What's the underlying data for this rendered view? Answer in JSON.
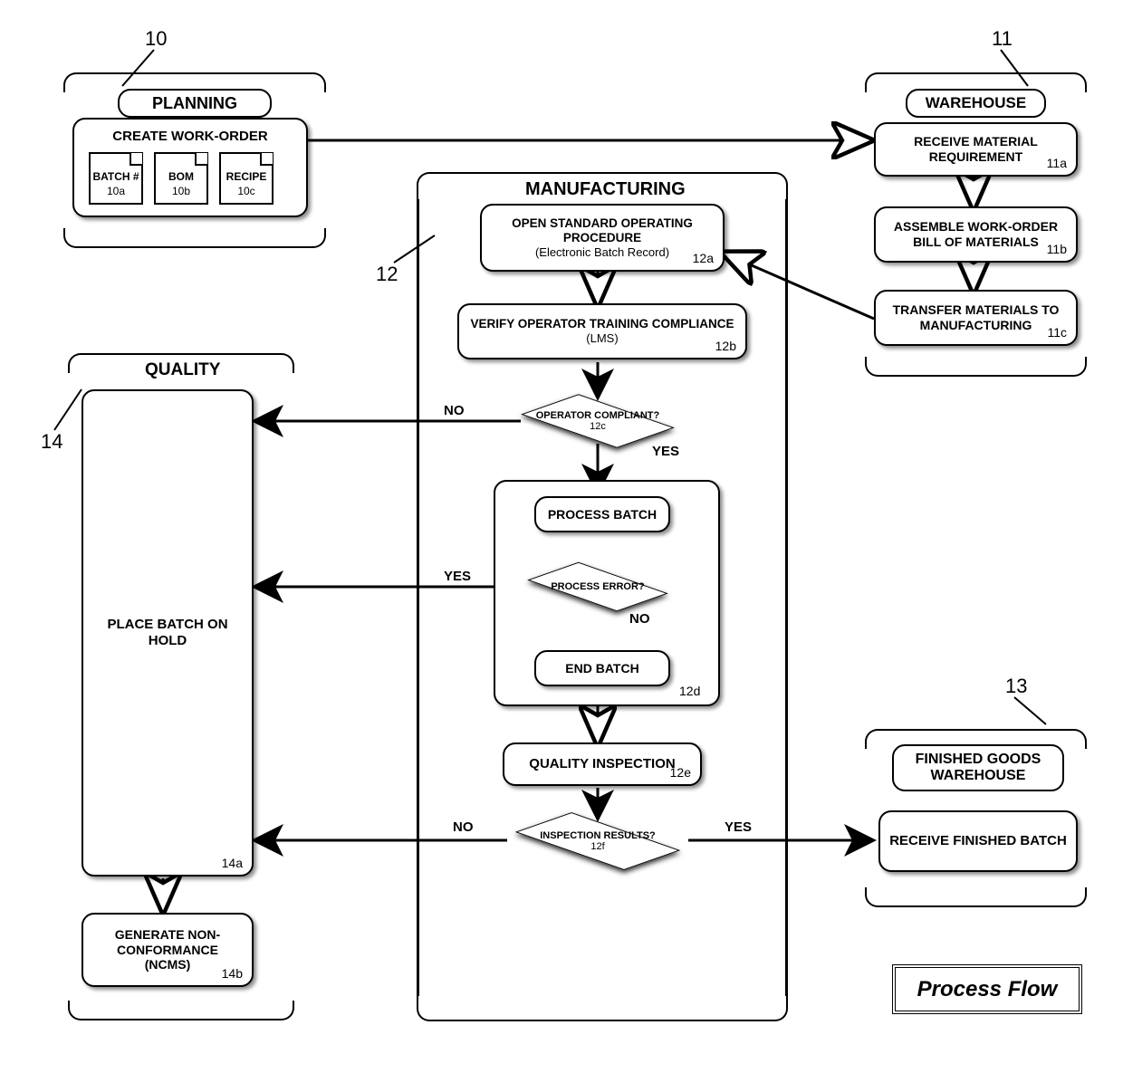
{
  "refs": {
    "planning": "10",
    "warehouse": "11",
    "manufacturing": "12",
    "finished": "13",
    "quality": "14"
  },
  "planning": {
    "title": "PLANNING",
    "create_wo": "CREATE WORK-ORDER",
    "docs": {
      "batch": {
        "label": "BATCH #",
        "tag": "10a"
      },
      "bom": {
        "label": "BOM",
        "tag": "10b"
      },
      "recipe": {
        "label": "RECIPE",
        "tag": "10c"
      }
    }
  },
  "warehouse": {
    "title": "WAREHOUSE",
    "recv": {
      "label": "RECEIVE MATERIAL REQUIREMENT",
      "tag": "11a"
    },
    "assemble": {
      "label": "ASSEMBLE WORK-ORDER BILL OF MATERIALS",
      "tag": "11b"
    },
    "transfer": {
      "label": "TRANSFER MATERIALS TO MANUFACTURING",
      "tag": "11c"
    }
  },
  "manufacturing": {
    "title": "MANUFACTURING",
    "open_sop": {
      "line1": "OPEN STANDARD OPERATING PROCEDURE",
      "line2": "(Electronic Batch Record)",
      "tag": "12a"
    },
    "verify": {
      "line1": "VERIFY OPERATOR TRAINING COMPLIANCE",
      "line2": "(LMS)",
      "tag": "12b"
    },
    "dec_compliant": {
      "label": "OPERATOR COMPLIANT?",
      "tag": "12c"
    },
    "process": "PROCESS BATCH",
    "dec_error": {
      "label": "PROCESS ERROR?"
    },
    "end": "END BATCH",
    "inner_tag": "12d",
    "inspect": {
      "label": "QUALITY INSPECTION",
      "tag": "12e"
    },
    "dec_results": {
      "label": "INSPECTION RESULTS?",
      "tag": "12f"
    }
  },
  "quality": {
    "title": "QUALITY",
    "hold": {
      "label": "PLACE BATCH ON HOLD",
      "tag": "14a"
    },
    "ncms": {
      "line1": "GENERATE NON-CONFORMANCE",
      "line2": "(NCMS)",
      "tag": "14b"
    }
  },
  "finished": {
    "title": "FINISHED GOODS WAREHOUSE",
    "recv": "RECEIVE FINISHED BATCH"
  },
  "labels": {
    "yes": "YES",
    "no": "NO"
  },
  "footer": "Process Flow"
}
